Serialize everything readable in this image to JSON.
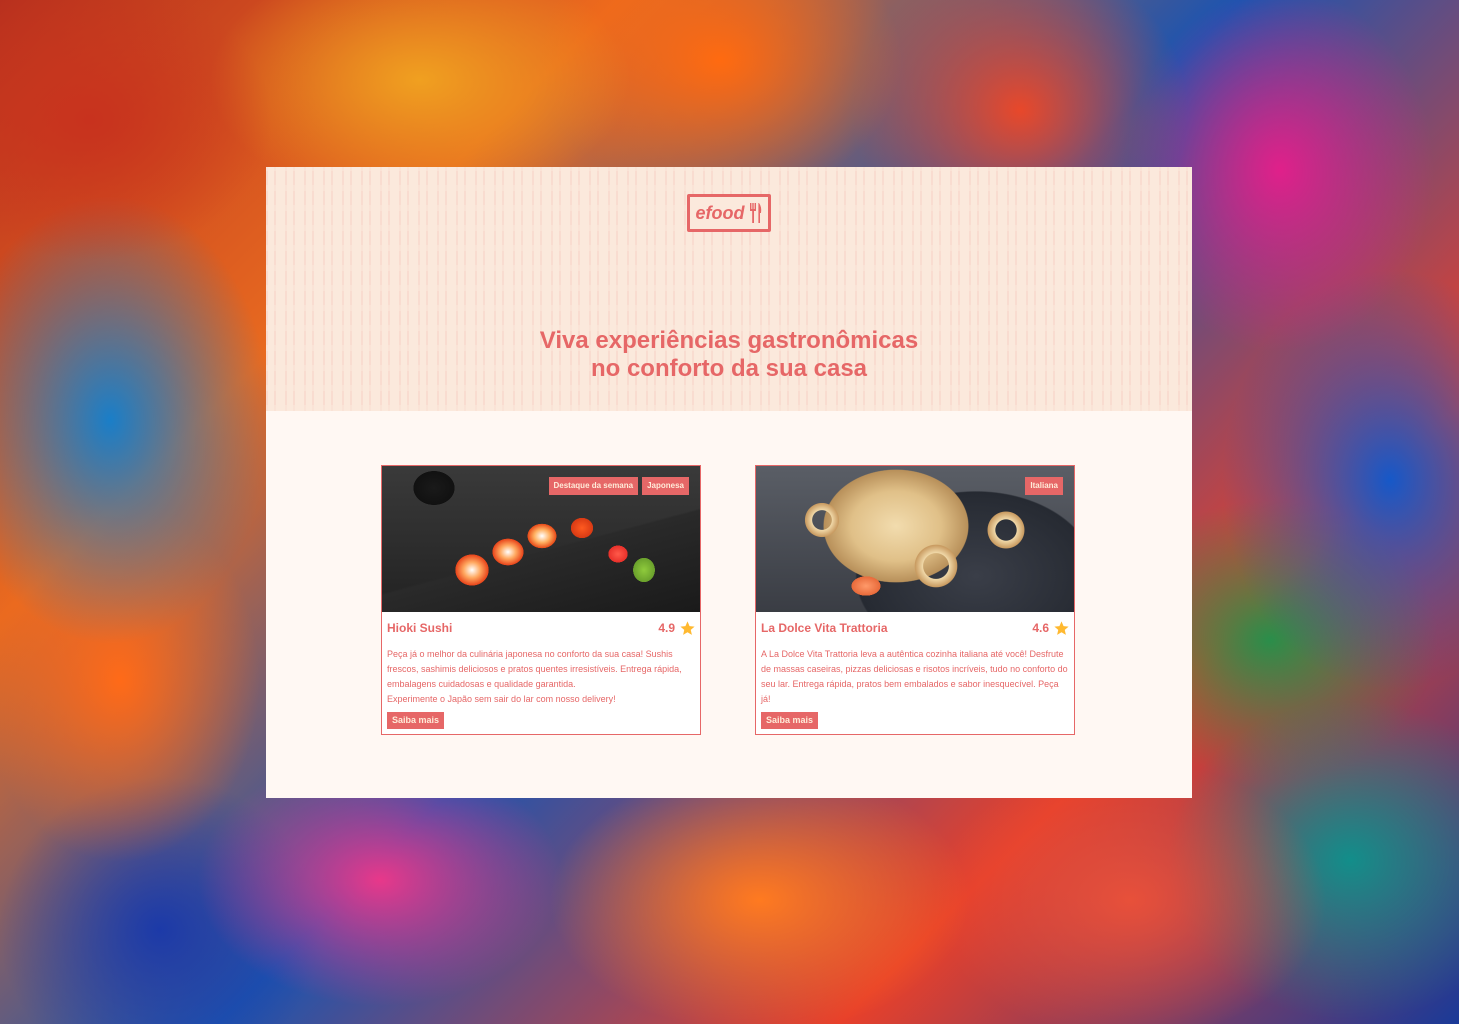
{
  "brand": {
    "name": "efood",
    "accent": "#e66767",
    "cream": "#fff8f3",
    "hero_bg": "#fbe9dc"
  },
  "hero": {
    "headline_line1": "Viva experiências gastronômicas",
    "headline_line2": "no conforto da sua casa"
  },
  "restaurants": [
    {
      "name": "Hioki Sushi",
      "rating": "4.9",
      "tags": [
        "Destaque da semana",
        "Japonesa"
      ],
      "description": "Peça já o melhor da culinária japonesa no conforto da sua casa! Sushis frescos, sashimis deliciosos e pratos quentes irresistíveis. Entrega rápida, embalagens cuidadosas e qualidade garantida.\nExperimente o Japão sem sair do lar com nosso delivery!",
      "button": "Saiba mais",
      "image": "sushi-photo"
    },
    {
      "name": "La Dolce Vita Trattoria",
      "rating": "4.6",
      "tags": [
        "Italiana"
      ],
      "description": "A La Dolce Vita Trattoria leva a autêntica cozinha italiana até você! Desfrute de massas caseiras, pizzas deliciosas e risotos incríveis, tudo no conforto do seu lar. Entrega rápida, pratos bem embalados e sabor inesquecível. Peça já!",
      "button": "Saiba mais",
      "image": "pasta-photo"
    }
  ]
}
